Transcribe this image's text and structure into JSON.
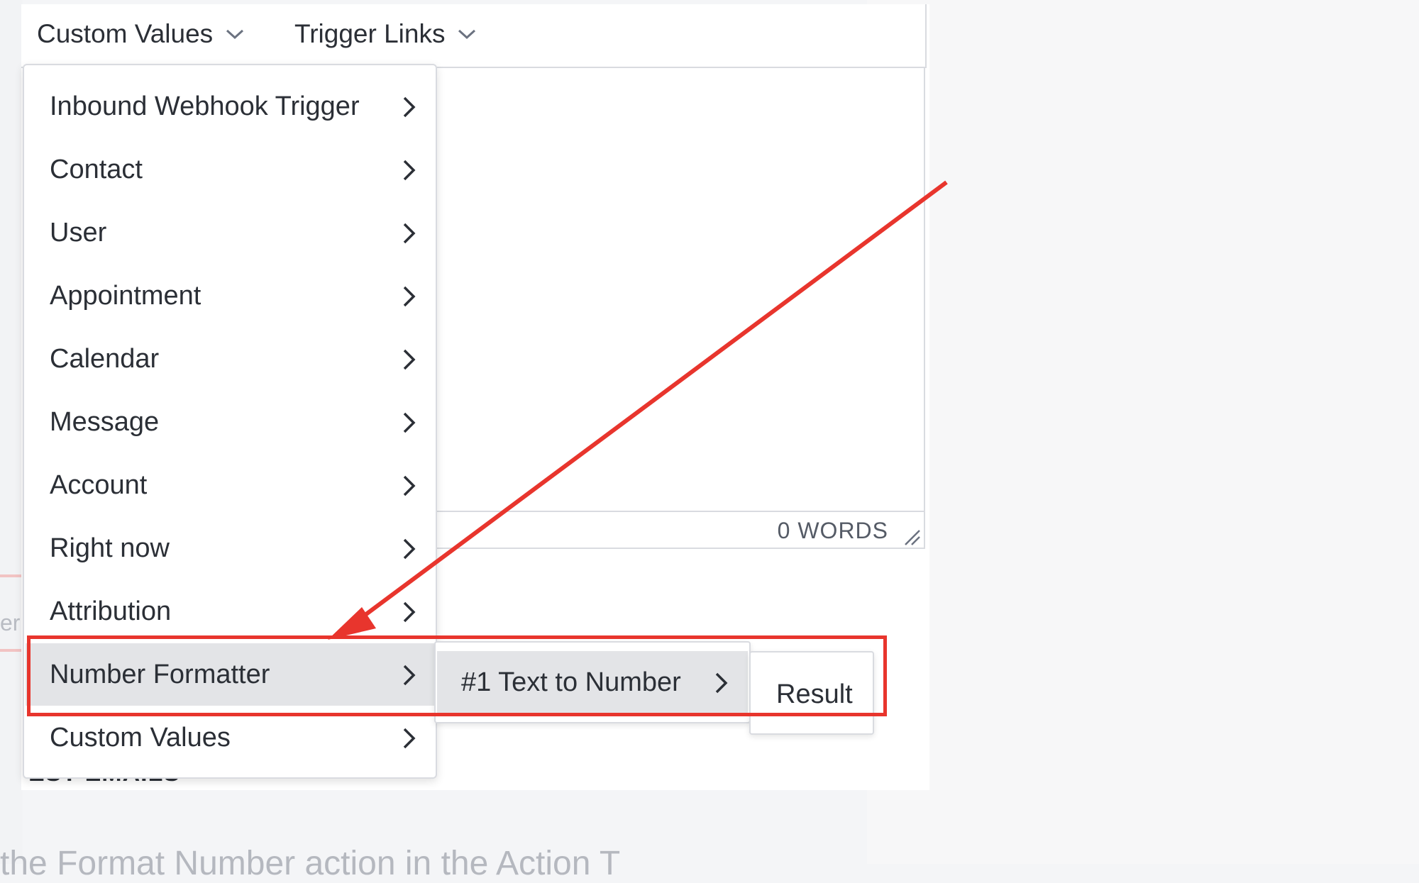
{
  "toolbar": {
    "custom_values_label": "Custom Values",
    "trigger_links_label": "Trigger Links"
  },
  "menu": {
    "items": [
      {
        "label": "Inbound Webhook Trigger"
      },
      {
        "label": "Contact"
      },
      {
        "label": "User"
      },
      {
        "label": "Appointment"
      },
      {
        "label": "Calendar"
      },
      {
        "label": "Message"
      },
      {
        "label": "Account"
      },
      {
        "label": "Right now"
      },
      {
        "label": "Attribution"
      },
      {
        "label": "Number Formatter"
      },
      {
        "label": "Custom Values"
      }
    ],
    "active_item": "Number Formatter"
  },
  "submenu": {
    "item_label": "#1 Text to Number"
  },
  "result": {
    "label": "Result"
  },
  "editor": {
    "word_count": "0 WORDS"
  },
  "background": {
    "left_fragment": "er",
    "heading": "EST EMAILS",
    "faded_text": "the Format Number action in the Action T"
  },
  "annotation": {
    "color": "#e8352d"
  }
}
